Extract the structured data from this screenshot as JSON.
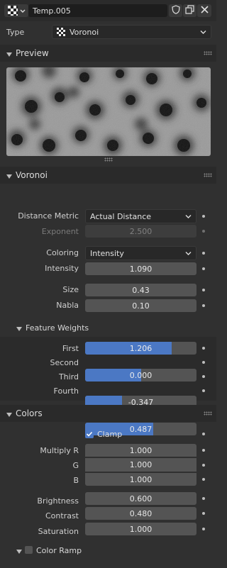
{
  "header": {
    "texture_name": "Temp.005",
    "icons": {
      "texture": "checker-texture-icon",
      "fake_user": "shield-icon",
      "duplicate": "duplicate-icon",
      "unlink": "close-icon"
    }
  },
  "type_row": {
    "label": "Type",
    "value": "Voronoi"
  },
  "preview": {
    "title": "Preview"
  },
  "voronoi": {
    "title": "Voronoi",
    "distance_metric": {
      "label": "Distance Metric",
      "value": "Actual Distance"
    },
    "exponent": {
      "label": "Exponent",
      "value": "2.500"
    },
    "coloring": {
      "label": "Coloring",
      "value": "Intensity"
    },
    "intensity": {
      "label": "Intensity",
      "value": "1.090"
    },
    "size": {
      "label": "Size",
      "value": "0.43"
    },
    "nabla": {
      "label": "Nabla",
      "value": "0.10"
    }
  },
  "feature_weights": {
    "title": "Feature Weights",
    "items": [
      {
        "label": "First",
        "value": "1.206",
        "fill": 0.78
      },
      {
        "label": "Second",
        "value": "0.000",
        "fill": 0.5
      },
      {
        "label": "Third",
        "value": "-0.347",
        "fill": 0.33
      },
      {
        "label": "Fourth",
        "value": "0.487",
        "fill": 0.61
      }
    ]
  },
  "colors": {
    "title": "Colors",
    "clamp": {
      "label": "Clamp",
      "checked": true
    },
    "multiply_r": {
      "label": "Multiply R",
      "value": "1.000"
    },
    "g": {
      "label": "G",
      "value": "1.000"
    },
    "b": {
      "label": "B",
      "value": "1.000"
    },
    "brightness": {
      "label": "Brightness",
      "value": "0.600"
    },
    "contrast": {
      "label": "Contrast",
      "value": "0.480"
    },
    "saturation": {
      "label": "Saturation",
      "value": "1.000"
    },
    "color_ramp": {
      "label": "Color Ramp",
      "checked": false
    }
  },
  "theme": {
    "accent": "#4b78c4",
    "panel_bg": "#303030",
    "field_bg": "#545454"
  }
}
